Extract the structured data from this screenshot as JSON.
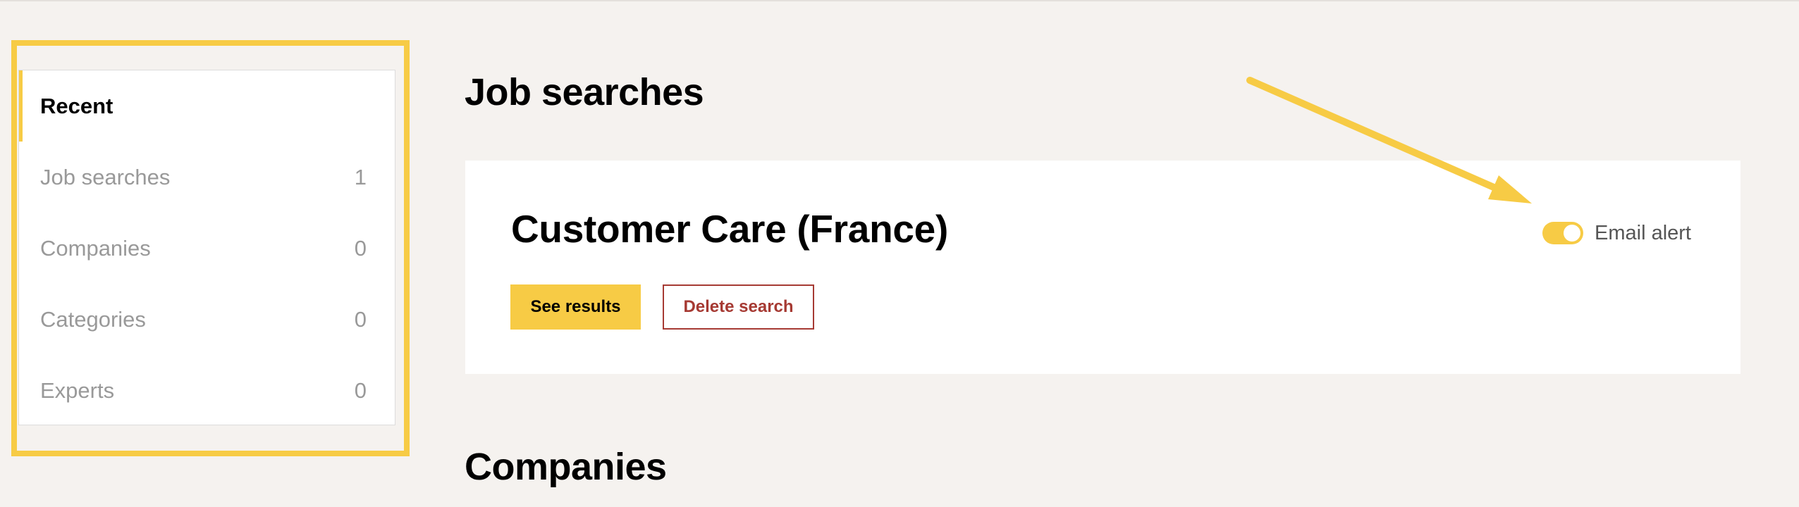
{
  "sidebar": {
    "items": [
      {
        "label": "Recent",
        "count": ""
      },
      {
        "label": "Job searches",
        "count": "1"
      },
      {
        "label": "Companies",
        "count": "0"
      },
      {
        "label": "Categories",
        "count": "0"
      },
      {
        "label": "Experts",
        "count": "0"
      }
    ]
  },
  "main": {
    "job_searches_title": "Job searches",
    "companies_title": "Companies",
    "search_card": {
      "title": "Customer Care (France)",
      "see_results_label": "See results",
      "delete_label": "Delete search",
      "email_alert_label": "Email alert",
      "email_alert_on": true
    }
  },
  "colors": {
    "accent": "#f7cb45",
    "danger": "#a63a33",
    "background": "#f5f2ef",
    "muted_text": "#999999"
  },
  "icons": {
    "annotation_arrow": "arrow-icon",
    "toggle": "toggle-switch"
  }
}
